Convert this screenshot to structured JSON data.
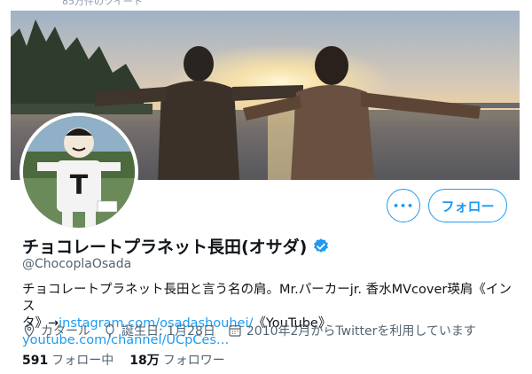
{
  "header_strip": {
    "faded_text": "85万件のツイート"
  },
  "profile": {
    "display_name": "チョコレートプラネット長田(オサダ)",
    "handle": "@ChocoplaOsada",
    "bio": {
      "text_line1": "チョコレートプラネット長田と言う名の肩。Mr.パーカーjr. 香水MVcover瑛肩《インス",
      "text_line2_prefix": "タ》→",
      "link1": "instagram.com/osadashouhei/",
      "text_mid": "《YouTube》",
      "link2": "youtube.com/channel/UCpCes…"
    },
    "meta": {
      "location": "カタール",
      "birthday": "誕生日: 1月28日",
      "joined": "2010年2月からTwitterを利用しています"
    },
    "counts": {
      "following_value": "591",
      "following_label": "フォロー中",
      "followers_value": "18万",
      "followers_label": "フォロワー"
    }
  },
  "actions": {
    "more_label": "•••",
    "follow_label": "フォロー"
  },
  "colors": {
    "accent": "#1d9bf0",
    "secondary_text": "#536471",
    "primary_text": "#0f1419"
  },
  "icons": [
    "more-icon",
    "verified-badge-icon",
    "location-icon",
    "birthday-icon",
    "calendar-icon"
  ]
}
